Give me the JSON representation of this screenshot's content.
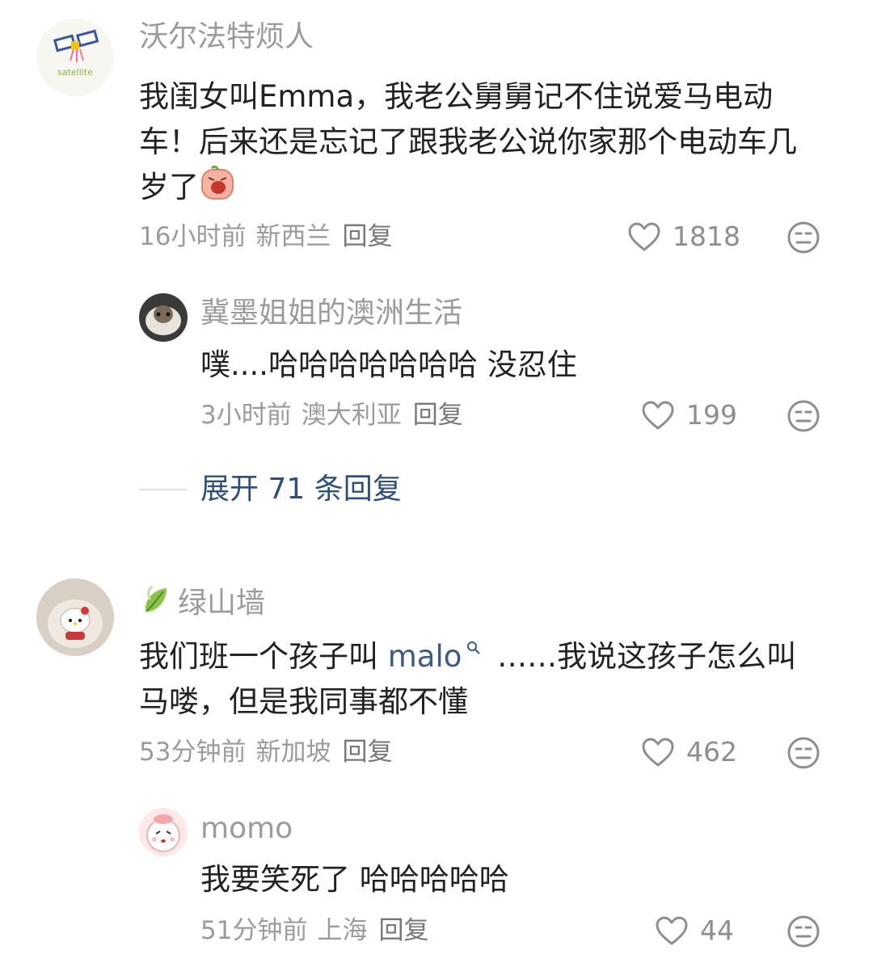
{
  "comments": [
    {
      "username": "沃尔法特烦人",
      "avatar_text": "satellite",
      "text": "我闺女叫Emma，我老公舅舅记不住说爱马电动车！后来还是忘记了跟我老公说你家那个电动车几岁了",
      "time": "16小时前",
      "location": "新西兰",
      "reply_label": "回复",
      "likes": "1818"
    },
    {
      "username": "冀墨姐姐的澳洲生活",
      "text": "噗....哈哈哈哈哈哈哈 没忍住",
      "time": "3小时前",
      "location": "澳大利亚",
      "reply_label": "回复",
      "likes": "199"
    },
    {
      "username": "绿山墙",
      "text_before": "我们班一个孩子叫 ",
      "mention": "malo",
      "text_after": " ……我说这孩子怎么叫马喽，但是我同事都不懂",
      "time": "53分钟前",
      "location": "新加坡",
      "reply_label": "回复",
      "likes": "462"
    },
    {
      "username": "momo",
      "text": "我要笑死了 哈哈哈哈哈",
      "time": "51分钟前",
      "location": "上海",
      "reply_label": "回复",
      "likes": "44"
    }
  ],
  "expand_replies": "展开 71 条回复",
  "icons": {
    "like": "heart-outline-icon",
    "dislike": "meh-face-icon",
    "mention": "search-icon",
    "leaf": "leaf-icon"
  },
  "colors": {
    "username": "#9b9b9b",
    "body": "#222222",
    "mention": "#3b5b86",
    "expand": "#2f4f7a"
  }
}
